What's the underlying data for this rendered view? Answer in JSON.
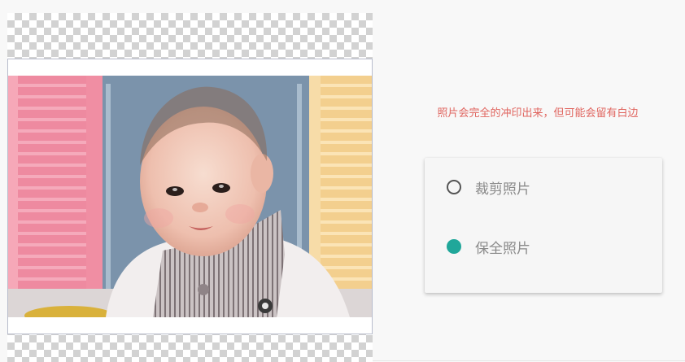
{
  "hint_text": "照片会完全的冲印出来，但可能会留有白边",
  "options": [
    {
      "label": "裁剪照片",
      "selected": false
    },
    {
      "label": "保全照片",
      "selected": true
    }
  ],
  "colors": {
    "hint": "#e0655f",
    "radio_checked": "#20a79a",
    "radio_unchecked": "#555555",
    "option_text": "#8a8a8a"
  }
}
